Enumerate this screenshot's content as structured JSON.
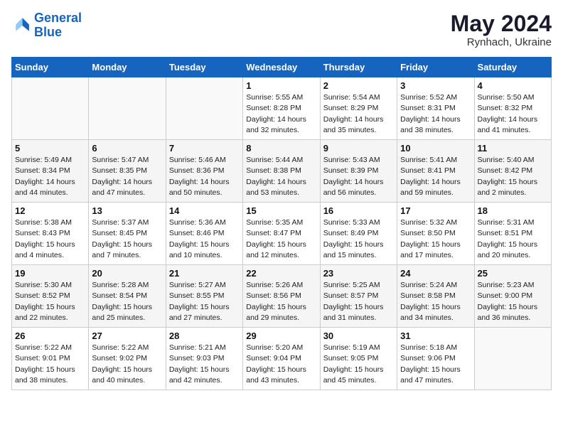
{
  "logo": {
    "text_general": "General",
    "text_blue": "Blue"
  },
  "header": {
    "month_year": "May 2024",
    "location": "Rynhach, Ukraine"
  },
  "weekdays": [
    "Sunday",
    "Monday",
    "Tuesday",
    "Wednesday",
    "Thursday",
    "Friday",
    "Saturday"
  ],
  "weeks": [
    [
      {
        "day": null
      },
      {
        "day": null
      },
      {
        "day": null
      },
      {
        "day": "1",
        "sunrise": "Sunrise: 5:55 AM",
        "sunset": "Sunset: 8:28 PM",
        "daylight": "Daylight: 14 hours and 32 minutes."
      },
      {
        "day": "2",
        "sunrise": "Sunrise: 5:54 AM",
        "sunset": "Sunset: 8:29 PM",
        "daylight": "Daylight: 14 hours and 35 minutes."
      },
      {
        "day": "3",
        "sunrise": "Sunrise: 5:52 AM",
        "sunset": "Sunset: 8:31 PM",
        "daylight": "Daylight: 14 hours and 38 minutes."
      },
      {
        "day": "4",
        "sunrise": "Sunrise: 5:50 AM",
        "sunset": "Sunset: 8:32 PM",
        "daylight": "Daylight: 14 hours and 41 minutes."
      }
    ],
    [
      {
        "day": "5",
        "sunrise": "Sunrise: 5:49 AM",
        "sunset": "Sunset: 8:34 PM",
        "daylight": "Daylight: 14 hours and 44 minutes."
      },
      {
        "day": "6",
        "sunrise": "Sunrise: 5:47 AM",
        "sunset": "Sunset: 8:35 PM",
        "daylight": "Daylight: 14 hours and 47 minutes."
      },
      {
        "day": "7",
        "sunrise": "Sunrise: 5:46 AM",
        "sunset": "Sunset: 8:36 PM",
        "daylight": "Daylight: 14 hours and 50 minutes."
      },
      {
        "day": "8",
        "sunrise": "Sunrise: 5:44 AM",
        "sunset": "Sunset: 8:38 PM",
        "daylight": "Daylight: 14 hours and 53 minutes."
      },
      {
        "day": "9",
        "sunrise": "Sunrise: 5:43 AM",
        "sunset": "Sunset: 8:39 PM",
        "daylight": "Daylight: 14 hours and 56 minutes."
      },
      {
        "day": "10",
        "sunrise": "Sunrise: 5:41 AM",
        "sunset": "Sunset: 8:41 PM",
        "daylight": "Daylight: 14 hours and 59 minutes."
      },
      {
        "day": "11",
        "sunrise": "Sunrise: 5:40 AM",
        "sunset": "Sunset: 8:42 PM",
        "daylight": "Daylight: 15 hours and 2 minutes."
      }
    ],
    [
      {
        "day": "12",
        "sunrise": "Sunrise: 5:38 AM",
        "sunset": "Sunset: 8:43 PM",
        "daylight": "Daylight: 15 hours and 4 minutes."
      },
      {
        "day": "13",
        "sunrise": "Sunrise: 5:37 AM",
        "sunset": "Sunset: 8:45 PM",
        "daylight": "Daylight: 15 hours and 7 minutes."
      },
      {
        "day": "14",
        "sunrise": "Sunrise: 5:36 AM",
        "sunset": "Sunset: 8:46 PM",
        "daylight": "Daylight: 15 hours and 10 minutes."
      },
      {
        "day": "15",
        "sunrise": "Sunrise: 5:35 AM",
        "sunset": "Sunset: 8:47 PM",
        "daylight": "Daylight: 15 hours and 12 minutes."
      },
      {
        "day": "16",
        "sunrise": "Sunrise: 5:33 AM",
        "sunset": "Sunset: 8:49 PM",
        "daylight": "Daylight: 15 hours and 15 minutes."
      },
      {
        "day": "17",
        "sunrise": "Sunrise: 5:32 AM",
        "sunset": "Sunset: 8:50 PM",
        "daylight": "Daylight: 15 hours and 17 minutes."
      },
      {
        "day": "18",
        "sunrise": "Sunrise: 5:31 AM",
        "sunset": "Sunset: 8:51 PM",
        "daylight": "Daylight: 15 hours and 20 minutes."
      }
    ],
    [
      {
        "day": "19",
        "sunrise": "Sunrise: 5:30 AM",
        "sunset": "Sunset: 8:52 PM",
        "daylight": "Daylight: 15 hours and 22 minutes."
      },
      {
        "day": "20",
        "sunrise": "Sunrise: 5:28 AM",
        "sunset": "Sunset: 8:54 PM",
        "daylight": "Daylight: 15 hours and 25 minutes."
      },
      {
        "day": "21",
        "sunrise": "Sunrise: 5:27 AM",
        "sunset": "Sunset: 8:55 PM",
        "daylight": "Daylight: 15 hours and 27 minutes."
      },
      {
        "day": "22",
        "sunrise": "Sunrise: 5:26 AM",
        "sunset": "Sunset: 8:56 PM",
        "daylight": "Daylight: 15 hours and 29 minutes."
      },
      {
        "day": "23",
        "sunrise": "Sunrise: 5:25 AM",
        "sunset": "Sunset: 8:57 PM",
        "daylight": "Daylight: 15 hours and 31 minutes."
      },
      {
        "day": "24",
        "sunrise": "Sunrise: 5:24 AM",
        "sunset": "Sunset: 8:58 PM",
        "daylight": "Daylight: 15 hours and 34 minutes."
      },
      {
        "day": "25",
        "sunrise": "Sunrise: 5:23 AM",
        "sunset": "Sunset: 9:00 PM",
        "daylight": "Daylight: 15 hours and 36 minutes."
      }
    ],
    [
      {
        "day": "26",
        "sunrise": "Sunrise: 5:22 AM",
        "sunset": "Sunset: 9:01 PM",
        "daylight": "Daylight: 15 hours and 38 minutes."
      },
      {
        "day": "27",
        "sunrise": "Sunrise: 5:22 AM",
        "sunset": "Sunset: 9:02 PM",
        "daylight": "Daylight: 15 hours and 40 minutes."
      },
      {
        "day": "28",
        "sunrise": "Sunrise: 5:21 AM",
        "sunset": "Sunset: 9:03 PM",
        "daylight": "Daylight: 15 hours and 42 minutes."
      },
      {
        "day": "29",
        "sunrise": "Sunrise: 5:20 AM",
        "sunset": "Sunset: 9:04 PM",
        "daylight": "Daylight: 15 hours and 43 minutes."
      },
      {
        "day": "30",
        "sunrise": "Sunrise: 5:19 AM",
        "sunset": "Sunset: 9:05 PM",
        "daylight": "Daylight: 15 hours and 45 minutes."
      },
      {
        "day": "31",
        "sunrise": "Sunrise: 5:18 AM",
        "sunset": "Sunset: 9:06 PM",
        "daylight": "Daylight: 15 hours and 47 minutes."
      },
      {
        "day": null
      }
    ]
  ]
}
